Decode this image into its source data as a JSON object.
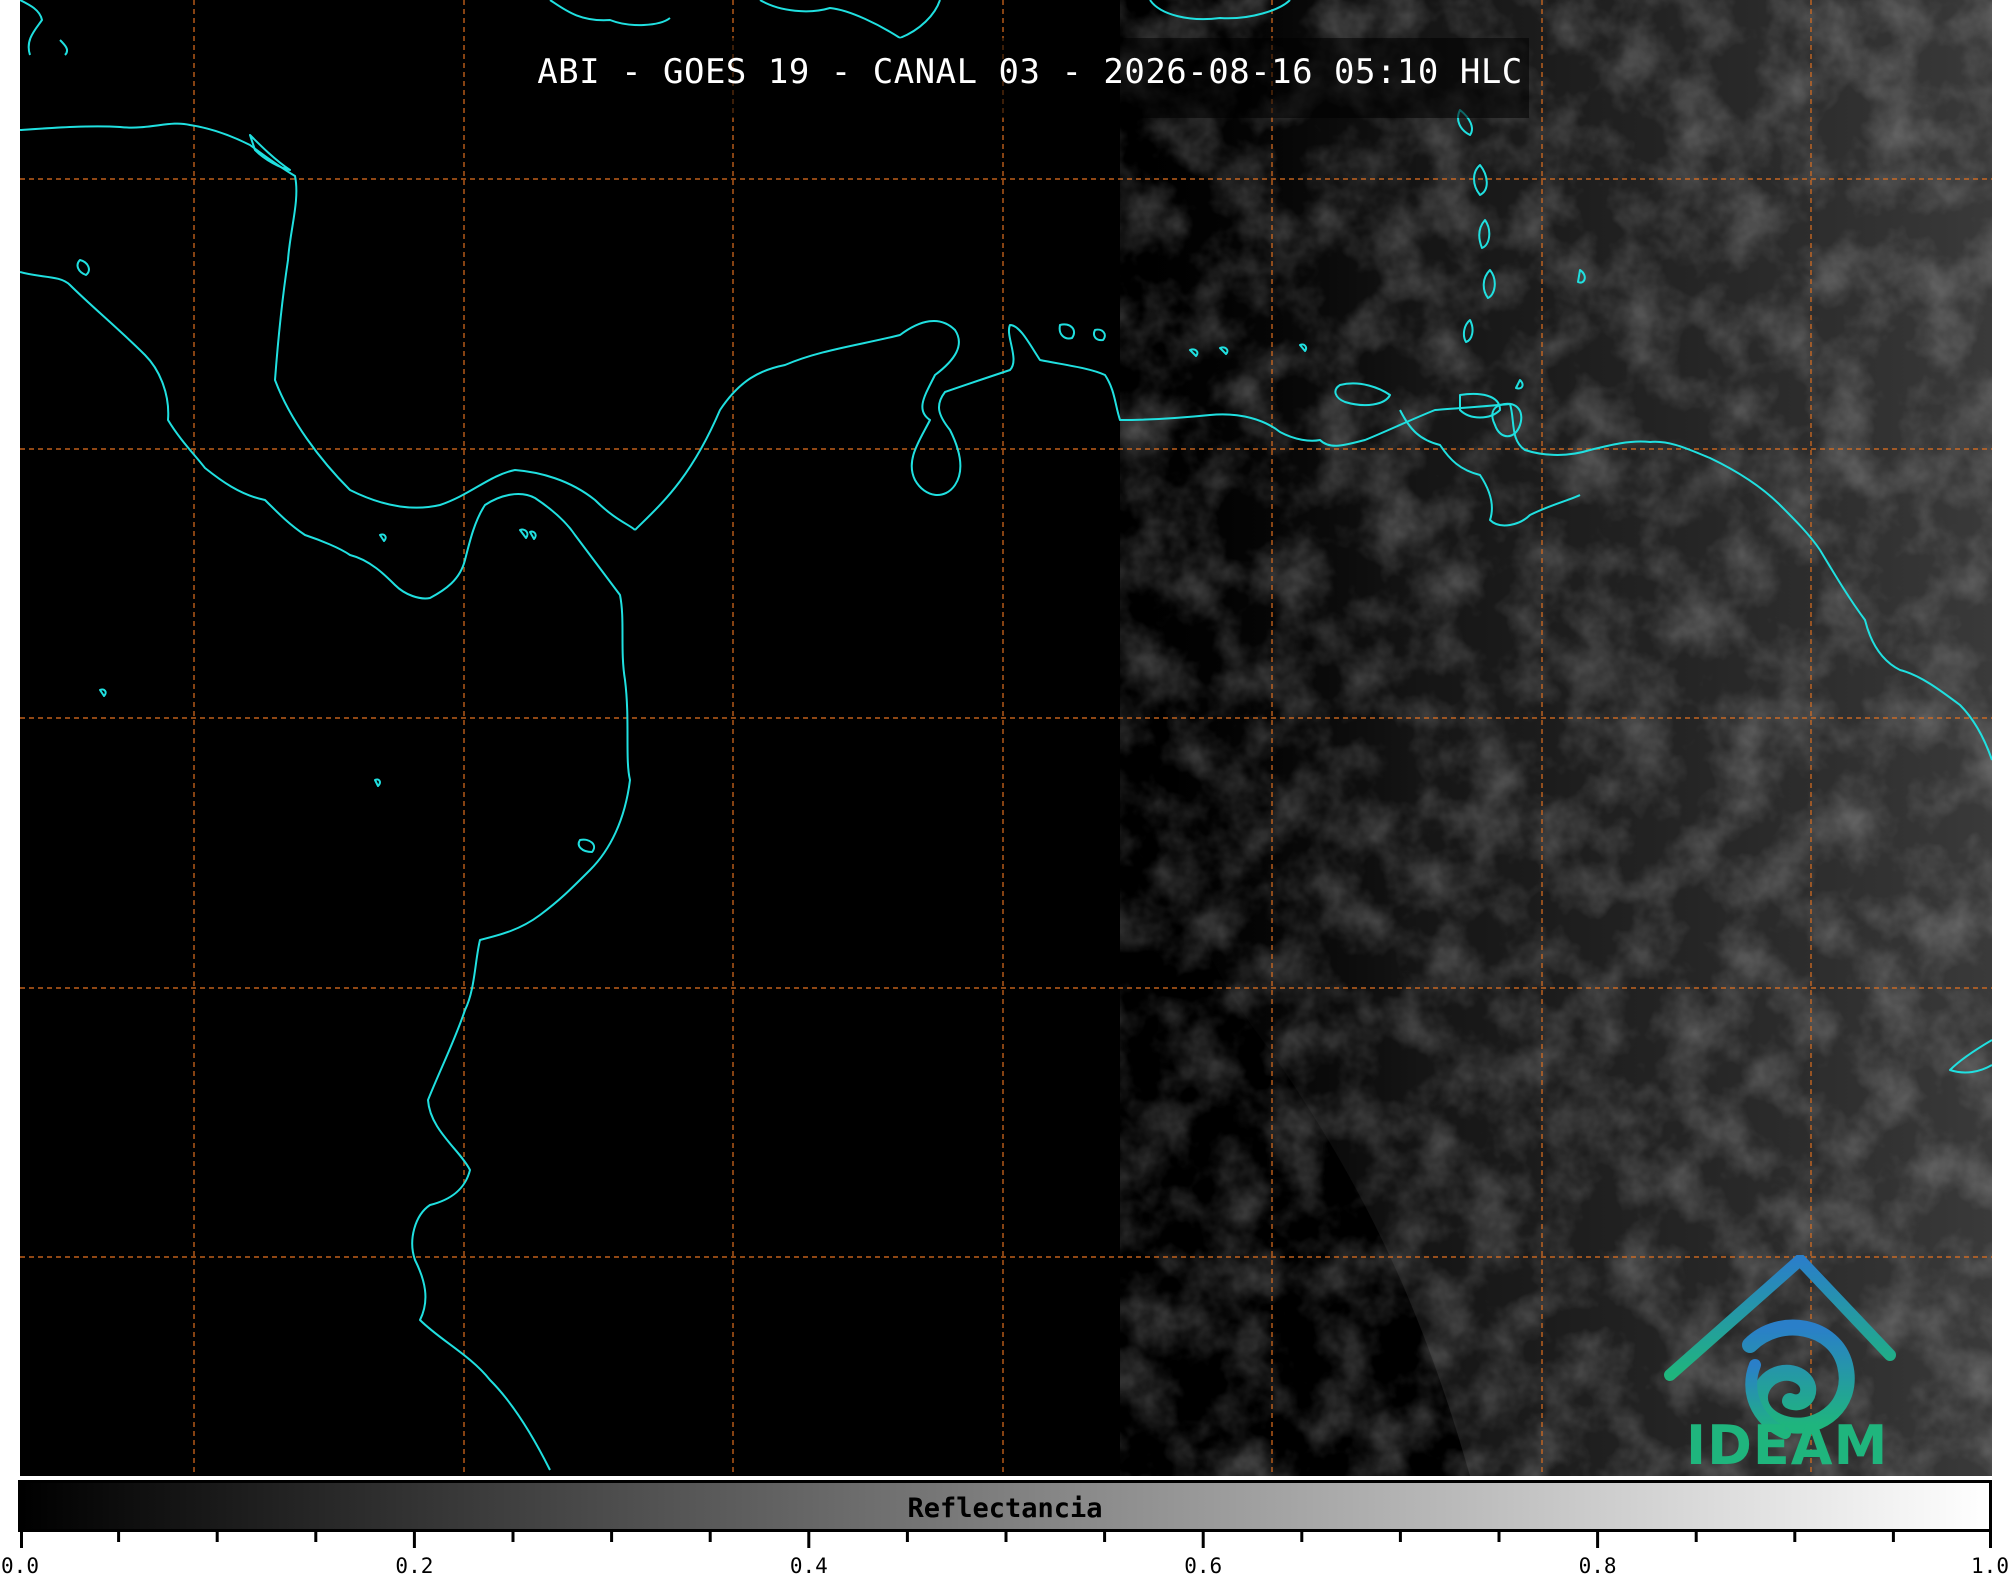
{
  "title": "ABI - GOES 19 - CANAL 03 - 2026-08-16 05:10 HLC",
  "logo": {
    "text": "IDEAM",
    "icon": "ideam-logo-icon",
    "color_primary": "#1fb57d",
    "color_secondary": "#2a7fc9"
  },
  "colorbar": {
    "label": "Reflectancia",
    "min": 0.0,
    "max": 1.0,
    "tick_labels": [
      "0.0",
      "0.2",
      "0.4",
      "0.6",
      "0.8",
      "1.0"
    ],
    "tick_values": [
      0.0,
      0.2,
      0.4,
      0.6,
      0.8,
      1.0
    ],
    "minor_tick_step": 0.05,
    "color_start": "#000000",
    "color_end": "#ffffff"
  },
  "map": {
    "background": "#000000",
    "coastline_color": "#20e0e0",
    "grid_color": "#e07020",
    "grid_style": "dashed"
  }
}
